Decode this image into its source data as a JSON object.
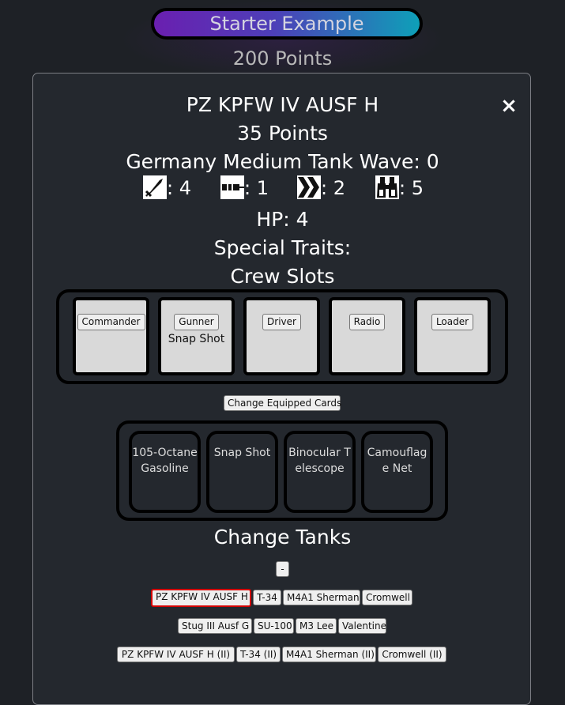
{
  "army": {
    "title": "Starter Example",
    "points": "200 Points"
  },
  "tank": {
    "name": "PZ KPFW IV AUSF H",
    "points": "35 Points",
    "nation_line": "Germany Medium Tank Wave: 0",
    "stats": [
      {
        "icon": "sword-icon",
        "value": ": 4"
      },
      {
        "icon": "syringe-icon",
        "value": ": 1"
      },
      {
        "icon": "chevrons-icon",
        "value": ": 2"
      },
      {
        "icon": "binoculars-icon",
        "value": ": 5"
      }
    ],
    "hp": "HP: 4",
    "traits_label": "Special Traits:",
    "close_symbol": "×"
  },
  "crew": {
    "title": "Crew Slots",
    "slots": [
      {
        "role": "Commander",
        "card": ""
      },
      {
        "role": "Gunner",
        "card": "Snap Shot"
      },
      {
        "role": "Driver",
        "card": ""
      },
      {
        "role": "Radio",
        "card": ""
      },
      {
        "role": "Loader",
        "card": ""
      }
    ]
  },
  "equipment": {
    "change_button": "Change Equipped Cards",
    "cards": [
      "105-Octane Gasoline",
      "Snap Shot",
      "Binocular Telescope",
      "Camouflage Net"
    ]
  },
  "change_tanks": {
    "title": "Change Tanks",
    "minus_button": "-",
    "selected": "PZ KPFW IV AUSF H",
    "rows": [
      [
        "PZ KPFW IV AUSF H",
        "T-34",
        "M4A1 Sherman",
        "Cromwell"
      ],
      [
        "Stug III Ausf G",
        "SU-100",
        "M3 Lee",
        "Valentine"
      ],
      [
        "PZ KPFW IV AUSF H (II)",
        "T-34 (II)",
        "M4A1 Sherman (II)",
        "Cromwell (II)"
      ]
    ]
  },
  "colors": {
    "selected_border": "#d40000",
    "title_gradient_start": "#6a1fb0",
    "title_gradient_end": "#0ea0b8"
  }
}
